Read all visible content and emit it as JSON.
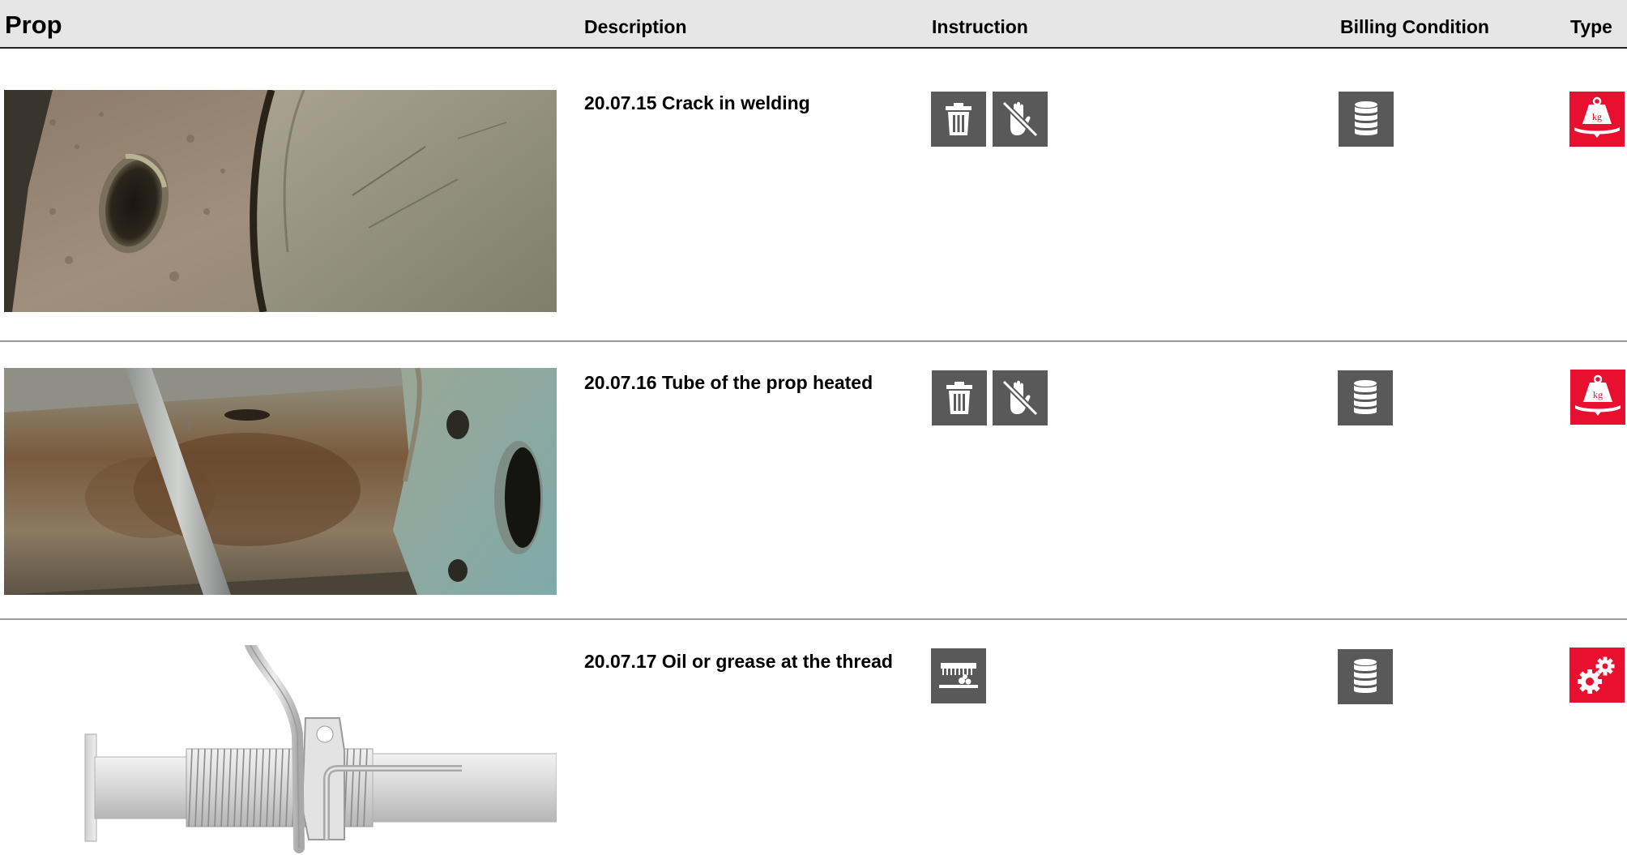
{
  "header": {
    "prop": "Prop",
    "description": "Description",
    "instruction": "Instruction",
    "billing_condition": "Billing Condition",
    "type": "Type"
  },
  "rows": [
    {
      "description": "20.07.15 Crack in welding",
      "photo": "photo-crack-in-welding",
      "instruction_icons": [
        "trash-icon",
        "no-touch-icon"
      ],
      "billing_icon": "coin-stack-icon",
      "type_icon": "weight-kg-icon"
    },
    {
      "description": "20.07.16 Tube of the prop heated",
      "photo": "photo-tube-heated",
      "instruction_icons": [
        "trash-icon",
        "no-touch-icon"
      ],
      "billing_icon": "coin-stack-icon",
      "type_icon": "weight-kg-icon"
    },
    {
      "description": "20.07.17 Oil or grease at the thread",
      "photo": "illustration-prop-thread",
      "instruction_icons": [
        "cleaning-brush-icon"
      ],
      "billing_icon": "coin-stack-icon",
      "type_icon": "gears-icon"
    }
  ],
  "icon_text": {
    "kg": "kg"
  },
  "colors": {
    "icon_gray": "#595959",
    "type_red": "#e8102e",
    "header_bg": "#e6e6e6"
  }
}
